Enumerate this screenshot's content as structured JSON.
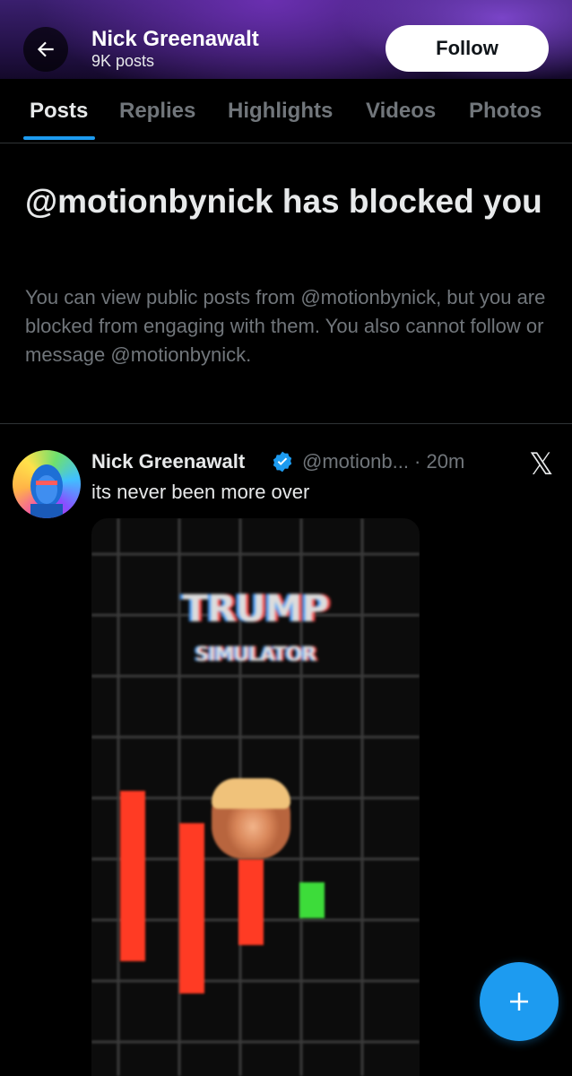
{
  "header": {
    "name": "Nick Greenawalt",
    "post_count": "9K posts",
    "follow_label": "Follow",
    "back_icon": "arrow-left-icon"
  },
  "tabs": [
    {
      "label": "Posts",
      "active": true
    },
    {
      "label": "Replies",
      "active": false
    },
    {
      "label": "Highlights",
      "active": false
    },
    {
      "label": "Videos",
      "active": false
    },
    {
      "label": "Photos",
      "active": false
    }
  ],
  "blocked_notice": {
    "title": "@motionbynick has blocked you",
    "description": "You can view public posts from @motionbynick, but you are blocked from engaging with them. You also cannot follow or message @motionbynick."
  },
  "post": {
    "author": "Nick Greenawalt",
    "handle_time": "@motionb... · 20m",
    "text": "its never been more over",
    "media": {
      "title_line1": "TRUMP",
      "title_line2": "SIMULATOR"
    }
  },
  "colors": {
    "accent": "#1d9bf0",
    "muted_text": "#71767b",
    "candle_red": "#ff3b24",
    "candle_green": "#3ddc3a"
  },
  "fab": {
    "icon": "plus-icon"
  }
}
